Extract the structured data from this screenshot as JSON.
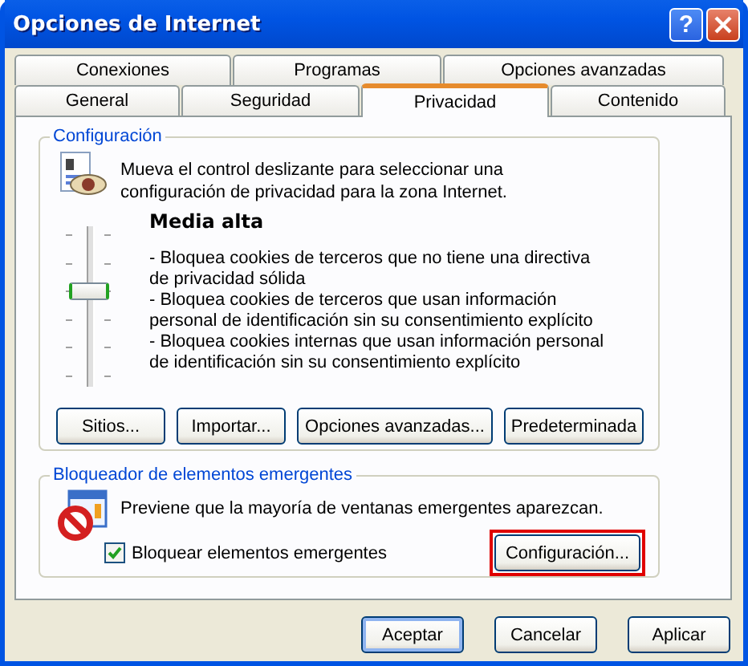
{
  "window": {
    "title": "Opciones de Internet",
    "help_button": "?"
  },
  "tab_rows": [
    [
      {
        "label": "Conexiones",
        "selected": false
      },
      {
        "label": "Programas",
        "selected": false
      },
      {
        "label": "Opciones avanzadas",
        "selected": false
      }
    ],
    [
      {
        "label": "General",
        "selected": false
      },
      {
        "label": "Seguridad",
        "selected": false
      },
      {
        "label": "Privacidad",
        "selected": true
      },
      {
        "label": "Contenido",
        "selected": false
      }
    ]
  ],
  "privacy": {
    "group_title": "Configuración",
    "description": "Mueva el control deslizante para seleccionar una configuración de privacidad para la zona Internet.",
    "slider": {
      "level": 0.6
    },
    "level_name": "Media alta",
    "details": [
      "- Bloquea cookies de terceros que no tiene una directiva de privacidad sólida",
      "- Bloquea cookies de terceros que usan información personal de identificación sin su consentimiento explícito",
      "- Bloquea cookies internas que usan información personal de identificación sin su consentimiento explícito"
    ],
    "buttons": [
      "Sitios...",
      "Importar...",
      "Opciones avanzadas...",
      "Predeterminada"
    ]
  },
  "popup_blocker": {
    "group_title": "Bloqueador de elementos emergentes",
    "description": "Previene que la mayoría de ventanas emergentes aparezcan.",
    "checkbox": {
      "label": "Bloquear elementos emergentes",
      "checked": true
    },
    "settings_button": {
      "label": "Configuración...",
      "highlighted": true
    }
  },
  "dialog_buttons": [
    {
      "label": "Aceptar",
      "default": true
    },
    {
      "label": "Cancelar",
      "default": false
    },
    {
      "label": "Aplicar",
      "default": false
    }
  ]
}
